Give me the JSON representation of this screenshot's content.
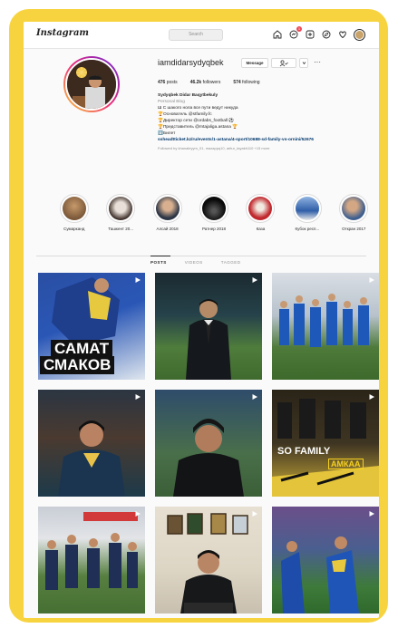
{
  "header": {
    "logo": "Instagram",
    "search_placeholder": "Search"
  },
  "profile": {
    "username": "iamdidarsydyqbek",
    "buttons": {
      "message": "Message",
      "follow": "",
      "more": "···"
    },
    "stats": {
      "posts_count": "476",
      "posts_label": "posts",
      "followers_count": "46.2k",
      "followers_label": "followers",
      "following_count": "574",
      "following_label": "following"
    },
    "bio": {
      "name": "Sydyqbek Didar Baqytbekuly",
      "category": "Personal Blog",
      "lines": [
        "Ш С шакого нола все пути ведут никуда",
        "🏆Основатель @stfamily.fc",
        "🏆Директор сети @ordabs_football ⚽",
        "🏆Представитель @mtajaliga.astana 🏆",
        "⬇️Билет"
      ],
      "link": "ssheadtticket.kz/ru/events/1-astana/4-sport/10688-sd-family-vs-ornini/52676",
      "followed_by": "Followed by khanaleyym_01, mazappq10, aritur_tayakh110 +15 more"
    }
  },
  "highlights": [
    {
      "label": "Сумарканд"
    },
    {
      "label": "Ташкент 20..."
    },
    {
      "label": "Алсай 2018"
    },
    {
      "label": "Ратнер 2018"
    },
    {
      "label": "Каза"
    },
    {
      "label": "Кубок респ..."
    },
    {
      "label": "Откран 2017"
    }
  ],
  "tabs": {
    "posts": "POSTS",
    "reels": "VIDEOS",
    "tagged": "TAGGED"
  },
  "posts": {
    "caption_1_line1": "САМАТ",
    "caption_1_line2": "СМАКОВ",
    "caption_6_line1": "SO FAMILY",
    "caption_6_line2": "АМКАА"
  },
  "colors": {
    "frame": "#f7d43f",
    "link": "#00376b",
    "notification": "#ed4956"
  }
}
